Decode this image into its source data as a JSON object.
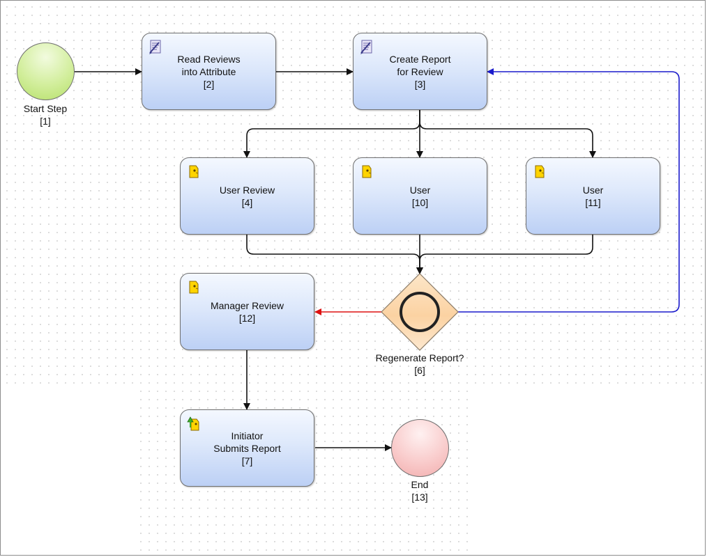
{
  "start": {
    "label": "Start Step",
    "id": "[1]",
    "color": "#c9ea8a"
  },
  "tasks": [
    {
      "key": "read",
      "lines": [
        "Read Reviews",
        "into Attribute"
      ],
      "id": "[2]",
      "icon": "script-icon"
    },
    {
      "key": "create",
      "lines": [
        "Create Report",
        "for Review"
      ],
      "id": "[3]",
      "icon": "script-icon"
    },
    {
      "key": "user-review",
      "lines": [
        "User Review"
      ],
      "id": "[4]",
      "icon": "user-task-icon"
    },
    {
      "key": "user10",
      "lines": [
        "User"
      ],
      "id": "[10]",
      "icon": "user-task-icon"
    },
    {
      "key": "user11",
      "lines": [
        "User"
      ],
      "id": "[11]",
      "icon": "user-task-icon"
    },
    {
      "key": "manager",
      "lines": [
        "Manager Review"
      ],
      "id": "[12]",
      "icon": "user-task-icon"
    },
    {
      "key": "initiator",
      "lines": [
        "Initiator",
        "Submits Report"
      ],
      "id": "[7]",
      "icon": "initiator-task-icon"
    }
  ],
  "gateway": {
    "label": "Regenerate Report?",
    "id": "[6]",
    "color": "#fcd3a3"
  },
  "end": {
    "label": "End",
    "id": "[13]",
    "color": "#f6c0c0"
  },
  "edge_colors": {
    "default": "#111111",
    "loop": "#1a1acc",
    "reject": "#dd1111"
  }
}
